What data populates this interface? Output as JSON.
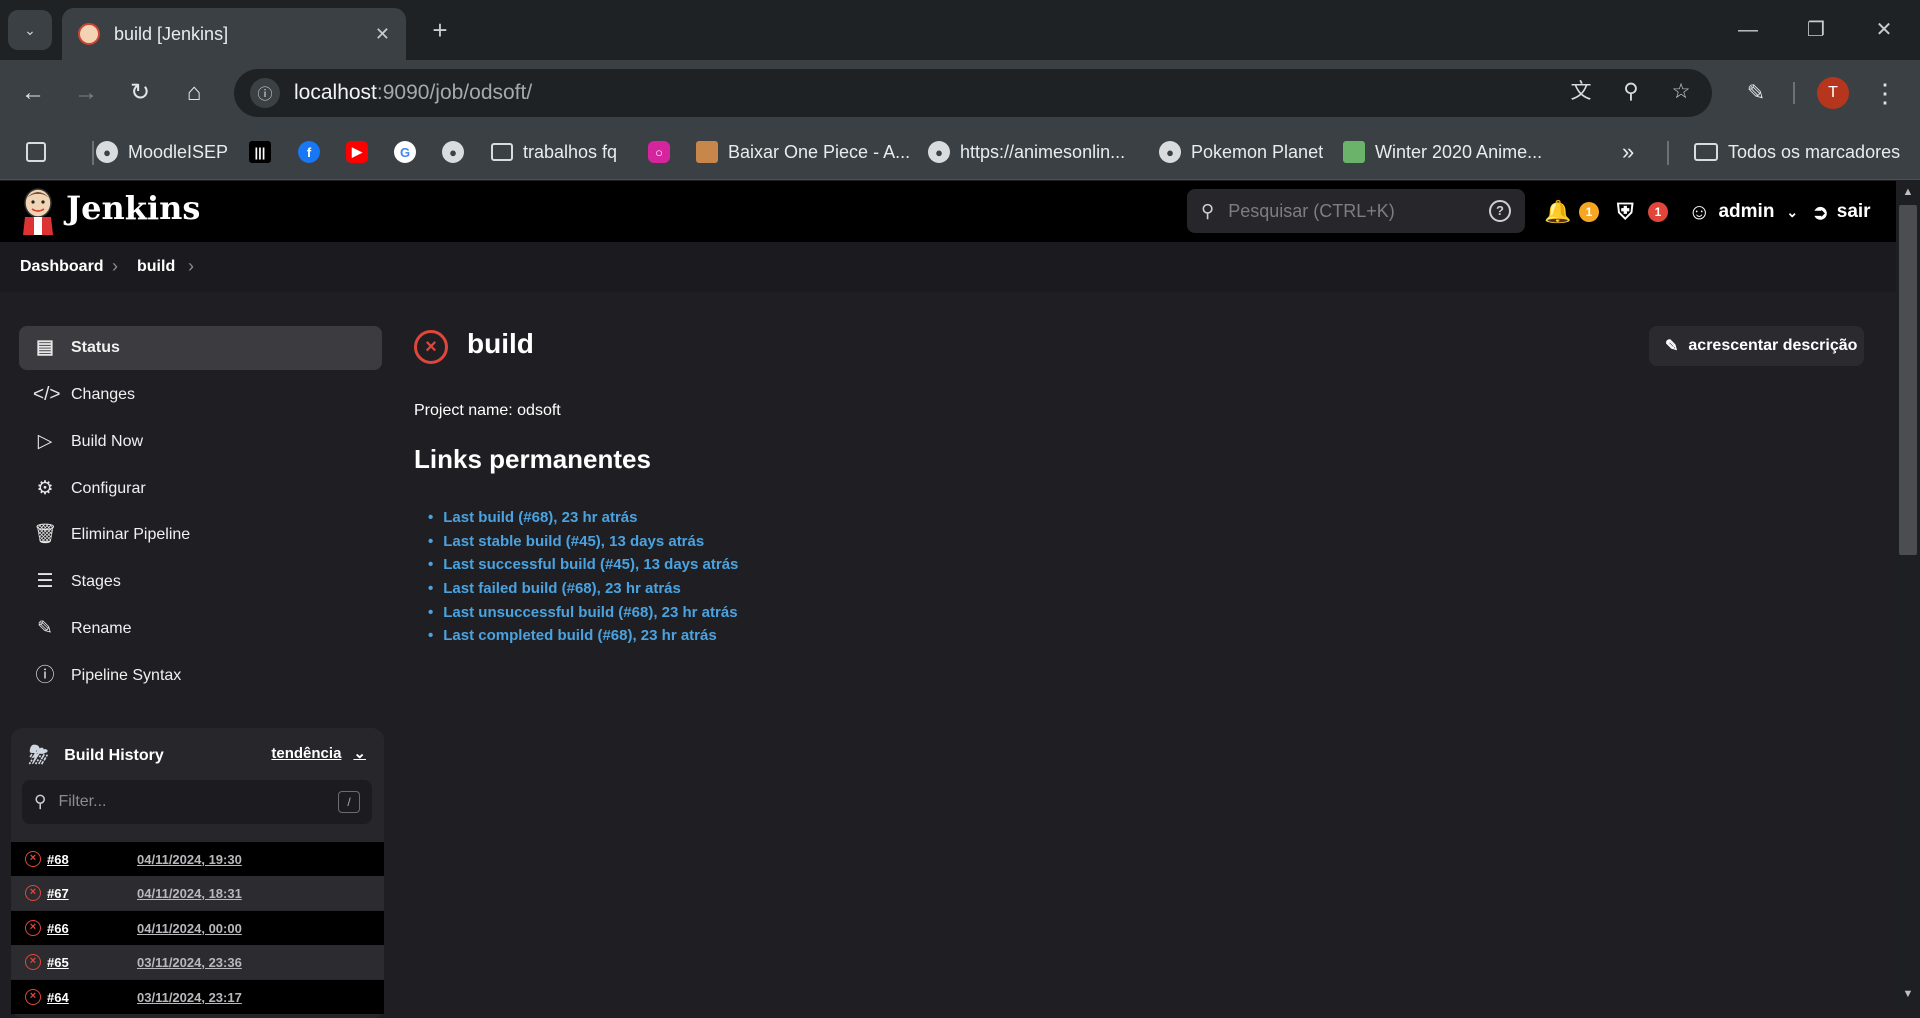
{
  "browser": {
    "tab_title": "build [Jenkins]",
    "url_host": "localhost",
    "url_rest": ":9090/job/odsoft/",
    "avatar_letter": "T",
    "bookmarks": [
      {
        "label": "MoodleISEP",
        "icon": "globe-icon"
      },
      {
        "label": "",
        "icon": "piano-icon"
      },
      {
        "label": "",
        "icon": "facebook-icon"
      },
      {
        "label": "",
        "icon": "youtube-icon"
      },
      {
        "label": "",
        "icon": "google-icon"
      },
      {
        "label": "",
        "icon": "globe-icon"
      },
      {
        "label": "trabalhos fq",
        "icon": "folder-icon"
      },
      {
        "label": "",
        "icon": "instagram-icon"
      },
      {
        "label": "Baixar One Piece - A...",
        "icon": "onepiece-icon"
      },
      {
        "label": "https://animesonlin...",
        "icon": "globe-icon"
      },
      {
        "label": "Pokemon Planet",
        "icon": "globe-icon"
      },
      {
        "label": "Winter 2020 Anime...",
        "icon": "anime-icon"
      }
    ],
    "all_bookmarks": "Todos os marcadores"
  },
  "jenkins": {
    "brand": "Jenkins",
    "search_placeholder": "Pesquisar (CTRL+K)",
    "notifications_count": "1",
    "security_count": "1",
    "user": "admin",
    "logout": "sair",
    "breadcrumbs": [
      "Dashboard",
      "build"
    ],
    "sidebar": [
      {
        "label": "Status",
        "icon": "document-icon",
        "active": true
      },
      {
        "label": "Changes",
        "icon": "code-icon"
      },
      {
        "label": "Build Now",
        "icon": "play-icon"
      },
      {
        "label": "Configurar",
        "icon": "gear-icon"
      },
      {
        "label": "Eliminar Pipeline",
        "icon": "trash-icon"
      },
      {
        "label": "Stages",
        "icon": "layers-icon"
      },
      {
        "label": "Rename",
        "icon": "pencil-icon"
      },
      {
        "label": "Pipeline Syntax",
        "icon": "question-icon"
      }
    ],
    "build_history": {
      "title": "Build History",
      "trend": "tendência",
      "filter_placeholder": "Filter...",
      "filter_key": "/",
      "rows": [
        {
          "num": "#68",
          "date": "04/11/2024, 19:30"
        },
        {
          "num": "#67",
          "date": "04/11/2024, 18:31"
        },
        {
          "num": "#66",
          "date": "04/11/2024, 00:00"
        },
        {
          "num": "#65",
          "date": "03/11/2024, 23:36"
        },
        {
          "num": "#64",
          "date": "03/11/2024, 23:17"
        }
      ]
    },
    "job_title": "build",
    "add_description": "acrescentar descrição",
    "project_name": "Project name: odsoft",
    "permalinks_title": "Links permanentes",
    "permalinks": [
      "Last build (#68), 23 hr atrás",
      "Last stable build (#45), 13 days atrás",
      "Last successful build (#45), 13 days atrás",
      "Last failed build (#68), 23 hr atrás",
      "Last unsuccessful build (#68), 23 hr atrás",
      "Last completed build (#68), 23 hr atrás"
    ]
  },
  "colors": {
    "failure": "#e0463a",
    "link": "#4aa3e0",
    "notification_badge": "#f5a623",
    "security_badge": "#e0463a"
  }
}
